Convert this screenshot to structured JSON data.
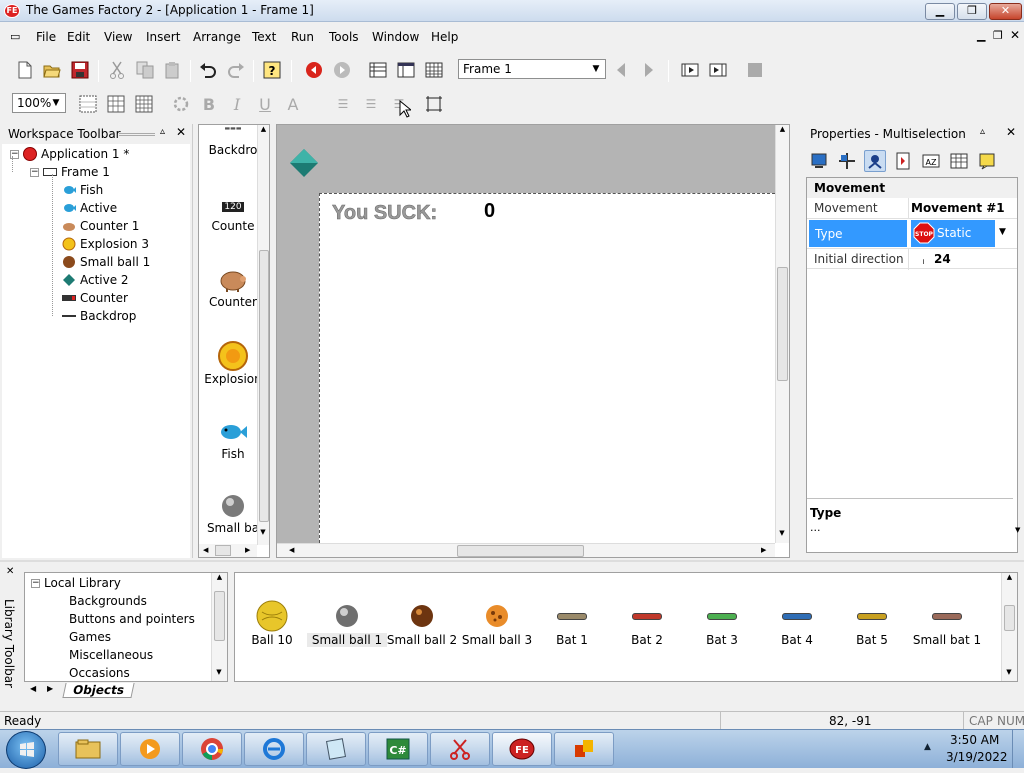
{
  "window": {
    "title": "The Games Factory 2 - [Application 1 - Frame 1]",
    "app_icon_label": "FE"
  },
  "menu": [
    "File",
    "Edit",
    "View",
    "Insert",
    "Arrange",
    "Text",
    "Run",
    "Tools",
    "Window",
    "Help"
  ],
  "toolbar": {
    "frame_select": "Frame 1",
    "zoom": "100%",
    "icons": [
      "new-icon",
      "open-icon",
      "save-icon",
      "cut-icon",
      "copy-icon",
      "paste-icon",
      "undo-icon",
      "redo-icon",
      "help-icon",
      "stop-icon",
      "play-icon",
      "storyboard-icon",
      "frame-editor-icon",
      "event-editor-icon",
      "previous-frame-icon",
      "next-frame-icon",
      "run-frame-icon",
      "run-application-icon",
      "stop-square-icon"
    ]
  },
  "workspace": {
    "title": "Workspace Toolbar",
    "tree": [
      {
        "label": "Application 1 *",
        "icon": "application-icon",
        "level": 0
      },
      {
        "label": "Frame 1",
        "icon": "frame-icon",
        "level": 1
      },
      {
        "label": "Fish",
        "icon": "fish-icon",
        "level": 2,
        "selected": true
      },
      {
        "label": "Active",
        "icon": "active-icon",
        "level": 2
      },
      {
        "label": "Counter 1",
        "icon": "counter-pig-icon",
        "level": 2
      },
      {
        "label": "Explosion 3",
        "icon": "explosion-icon",
        "level": 2
      },
      {
        "label": "Small ball 1",
        "icon": "ball-icon",
        "level": 2
      },
      {
        "label": "Active 2",
        "icon": "diamond-icon",
        "level": 2
      },
      {
        "label": "Counter",
        "icon": "counter-icon",
        "level": 2
      },
      {
        "label": "Backdrop",
        "icon": "backdrop-icon",
        "level": 2
      }
    ]
  },
  "object_list": [
    {
      "label": "Backdro",
      "icon": "backdrop-icon"
    },
    {
      "label": "Counte",
      "icon": "counter-icon",
      "number": "120"
    },
    {
      "label": "Counter",
      "icon": "counter-pig-icon"
    },
    {
      "label": "Explosion",
      "icon": "explosion-icon"
    },
    {
      "label": "Fish",
      "icon": "fish-icon"
    },
    {
      "label": "Small ba",
      "icon": "ball-icon"
    }
  ],
  "frame": {
    "score_label": "You SUCK:",
    "score_value": "0"
  },
  "properties": {
    "title": "Properties - Multiselection",
    "tab_icons": [
      "display-icon",
      "size-position-icon",
      "movement-icon",
      "runtime-options-icon",
      "values-icon",
      "events-icon",
      "about-icon"
    ],
    "section": "Movement",
    "rows": [
      {
        "name": "Movement",
        "value": "Movement #1"
      },
      {
        "name": "Type",
        "value": "Static"
      },
      {
        "name": "Initial direction",
        "value": "24"
      }
    ],
    "help_title": "Type",
    "help_text": "..."
  },
  "library": {
    "sidebar_title": "Library Toolbar",
    "tree_root": "Local Library",
    "tree": [
      "Backgrounds",
      "Buttons and pointers",
      "Games",
      "Miscellaneous",
      "Occasions"
    ],
    "tab": "Objects",
    "items": [
      {
        "label": "Ball 10",
        "icon": "yellow-ball-icon"
      },
      {
        "label": "Small ball 1",
        "icon": "grey-ball-icon"
      },
      {
        "label": "Small ball 2",
        "icon": "brown-ball-icon"
      },
      {
        "label": "Small ball 3",
        "icon": "cookie-ball-icon"
      },
      {
        "label": "Bat 1",
        "icon": "bat-icon",
        "color": "#9a8a6a"
      },
      {
        "label": "Bat 2",
        "icon": "bat-icon",
        "color": "#c0392b"
      },
      {
        "label": "Bat 3",
        "icon": "bat-icon",
        "color": "#4caf50"
      },
      {
        "label": "Bat 4",
        "icon": "bat-icon",
        "color": "#2f6db5"
      },
      {
        "label": "Bat 5",
        "icon": "bat-icon",
        "color": "#c8a020"
      },
      {
        "label": "Small bat 1",
        "icon": "bat-icon",
        "color": "#9a6a5a"
      }
    ]
  },
  "status": {
    "text": "Ready",
    "coords": "82, -91",
    "cap": "CAP",
    "num": "NUM"
  },
  "taskbar": {
    "apps": [
      "explorer-icon",
      "media-player-icon",
      "chrome-icon",
      "internet-explorer-icon",
      "notepad-icon",
      "csharp-icon",
      "snipping-tool-icon",
      "games-factory-icon",
      "office-icon"
    ],
    "time": "3:50 AM",
    "date": "3/19/2022"
  }
}
